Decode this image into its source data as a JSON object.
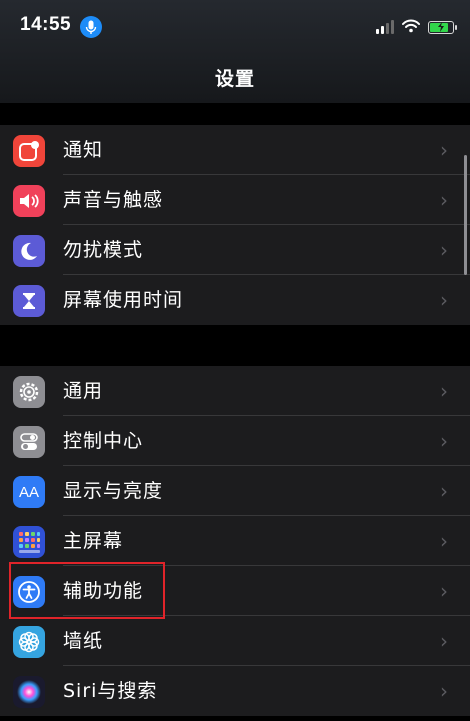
{
  "status_bar": {
    "time": "14:55"
  },
  "nav": {
    "title": "设置"
  },
  "groups": [
    {
      "items": [
        {
          "label": "通知",
          "icon": "notification-icon",
          "color": "#f0453a"
        },
        {
          "label": "声音与触感",
          "icon": "speaker-icon",
          "color": "#f0415a"
        },
        {
          "label": "勿扰模式",
          "icon": "moon-icon",
          "color": "#5c5bd6"
        },
        {
          "label": "屏幕使用时间",
          "icon": "hourglass-icon",
          "color": "#5c5bd6"
        }
      ]
    },
    {
      "items": [
        {
          "label": "通用",
          "icon": "gear-icon",
          "color": "#8e8e93"
        },
        {
          "label": "控制中心",
          "icon": "toggles-icon",
          "color": "#8e8e93"
        },
        {
          "label": "显示与亮度",
          "icon": "text-size-icon",
          "color": "#2f7bf6"
        },
        {
          "label": "主屏幕",
          "icon": "home-grid-icon",
          "color": "#3051d6"
        },
        {
          "label": "辅助功能",
          "icon": "accessibility-icon",
          "color": "#2f7bf6"
        },
        {
          "label": "墙纸",
          "icon": "flower-icon",
          "color": "#35a4e0"
        },
        {
          "label": "Siri与搜索",
          "icon": "siri-icon",
          "color": "#1a1a2e"
        }
      ]
    }
  ],
  "icons_text": {
    "display_glyph": "AA"
  },
  "highlight_target": "辅助功能"
}
